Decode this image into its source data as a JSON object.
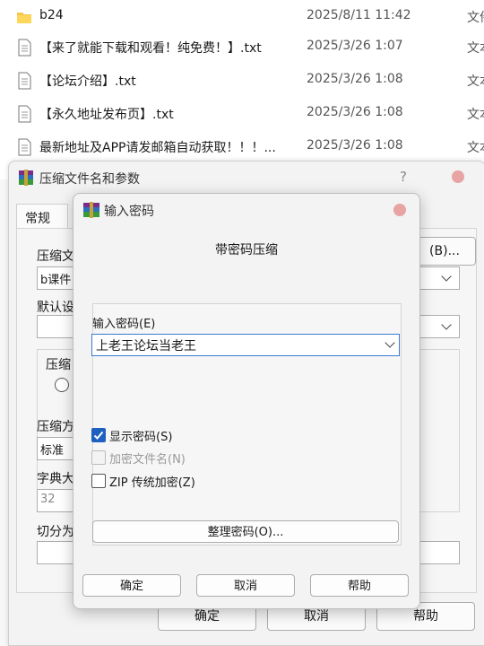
{
  "files": [
    {
      "name": "b24",
      "date": "2025/8/11 11:42",
      "type": "文件",
      "icon": "folder-icon"
    },
    {
      "name": "【来了就能下载和观看！纯免费！】.txt",
      "date": "2025/3/26 1:07",
      "type": "文本",
      "icon": "text-file-icon"
    },
    {
      "name": "【论坛介绍】.txt",
      "date": "2025/3/26 1:08",
      "type": "文本",
      "icon": "text-file-icon"
    },
    {
      "name": "【永久地址发布页】.txt",
      "date": "2025/3/26 1:08",
      "type": "文本",
      "icon": "text-file-icon"
    },
    {
      "name": "最新地址及APP请发邮箱自动获取！！！...",
      "date": "2025/3/26 1:08",
      "type": "文本",
      "icon": "text-file-icon"
    }
  ],
  "archive_dialog": {
    "title": "压缩文件名和参数",
    "help_symbol": "?",
    "tab": "常规",
    "labels": {
      "archive_name": "压缩文",
      "archive_value": "b课件",
      "default": "默认设",
      "compress_group": "压缩",
      "method": "压缩方",
      "method_value": "标准",
      "dict": "字典大",
      "dict_value": "32",
      "split": "切分为"
    },
    "browse_button": "(B)...",
    "ok": "确定",
    "cancel": "取消",
    "help": "帮助"
  },
  "password_dialog": {
    "title": "输入密码",
    "heading": "带密码压缩",
    "input_label": "输入密码(E)",
    "password_value": "上老王论坛当老王",
    "show_password": {
      "label": "显示密码(S)",
      "checked": true
    },
    "encrypt_names": {
      "label": "加密文件名(N)",
      "checked": false,
      "disabled": true
    },
    "zip_legacy": {
      "label": "ZIP 传统加密(Z)",
      "checked": false
    },
    "organize_button": "整理密码(O)...",
    "ok": "确定",
    "cancel": "取消",
    "help": "帮助"
  },
  "colors": {
    "accent": "#1f5fbf",
    "close_dot": "#e8a3a3"
  }
}
